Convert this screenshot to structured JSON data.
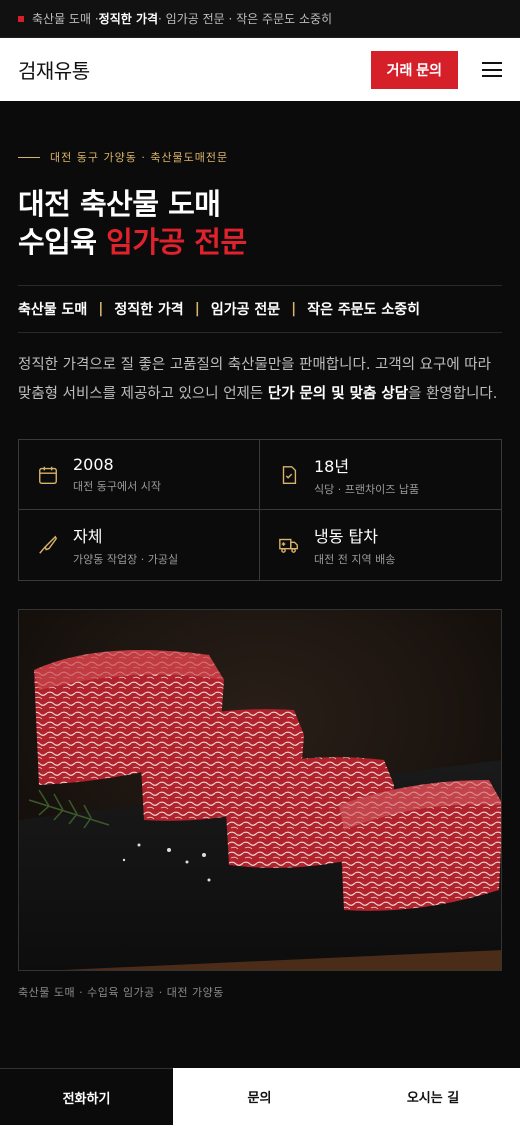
{
  "topbar": {
    "part1": "축산물 도매 · ",
    "part2": "정직한 가격",
    "part3": " · 임가공 전문 · 작은 주문도 소중히"
  },
  "header": {
    "brand": "검재유통",
    "cta": "거래 문의"
  },
  "hero": {
    "eyebrow": "대전 동구 가양동 · 축산물도매전문",
    "title_line1": "대전 축산물 도매",
    "title_line2_plain": "수입육 ",
    "title_line2_accent": "임가공 전문"
  },
  "tags": [
    "축산물 도매",
    "정직한 가격",
    "임가공 전문",
    "작은 주문도 소중히"
  ],
  "description": {
    "text1": "정직한 가격으로 질 좋은 고품질의 축산물만을 판매합니다. 고객의 요구에 따라 맞춤형 서비스를 제공하고 있으니 언제든 ",
    "bold": "단가 문의 및 맞춤 상담",
    "text2": "을 환영합니다."
  },
  "stats": [
    {
      "value": "2008",
      "sub": "대전 동구에서 시작",
      "icon": "calendar-icon"
    },
    {
      "value": "18년",
      "sub": "식당 · 프랜차이즈 납품",
      "icon": "document-check-icon"
    },
    {
      "value": "자체",
      "sub": "가양동 작업장 · 가공실",
      "icon": "knife-icon"
    },
    {
      "value": "냉동 탑차",
      "sub": "대전 전 지역 배송",
      "icon": "truck-icon"
    }
  ],
  "caption": "축산물 도매 · 수입육 임가공 · 대전 가양동",
  "bottom_nav": {
    "call": "전화하기",
    "ask": "문의",
    "map": "오시는 길"
  },
  "colors": {
    "accent": "#d5202a",
    "gold": "#d9b36a",
    "background": "#0b0b0b"
  }
}
